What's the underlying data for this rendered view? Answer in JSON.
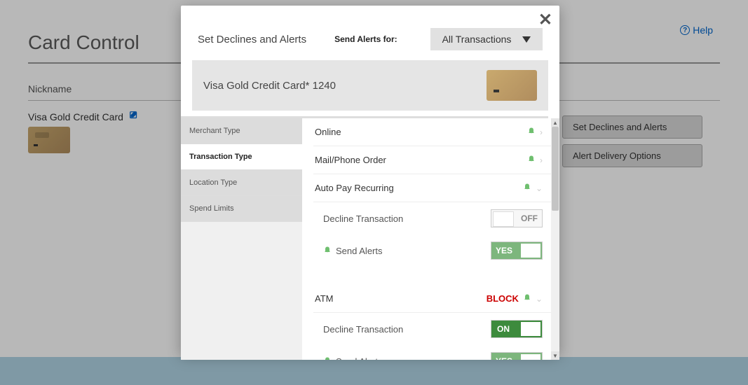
{
  "help": {
    "label": "Help"
  },
  "page": {
    "title": "Card Control",
    "nickname_label": "Nickname"
  },
  "card": {
    "name": "Visa Gold Credit Card"
  },
  "buttons": {
    "set_declines": "Set Declines and Alerts",
    "alert_delivery": "Alert Delivery Options"
  },
  "modal": {
    "title": "Set Declines and Alerts",
    "send_alerts_for": "Send Alerts for:",
    "dropdown_selected": "All Transactions",
    "card_display": "Visa Gold Credit Card* 1240",
    "tabs": [
      "Merchant Type",
      "Transaction Type",
      "Location Type",
      "Spend Limits"
    ],
    "active_tab_index": 1,
    "rows": {
      "online": "Online",
      "mail_phone": "Mail/Phone Order",
      "auto_pay": "Auto Pay Recurring",
      "atm": "ATM"
    },
    "sub_labels": {
      "decline": "Decline Transaction",
      "send_alerts": "Send Alerts"
    },
    "toggle_labels": {
      "off": "OFF",
      "on": "ON",
      "yes": "YES"
    },
    "block_label": "BLOCK"
  }
}
